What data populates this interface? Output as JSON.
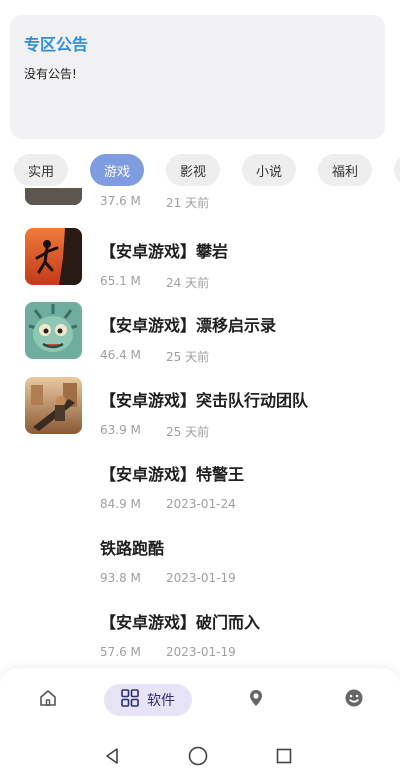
{
  "notice": {
    "title": "专区公告",
    "body": "没有公告!"
  },
  "tabs": [
    {
      "label": "实用",
      "active": false
    },
    {
      "label": "游戏",
      "active": true
    },
    {
      "label": "影视",
      "active": false
    },
    {
      "label": "小说",
      "active": false
    },
    {
      "label": "福利",
      "active": false
    }
  ],
  "items": [
    {
      "title": "",
      "size": "37.6 M",
      "date": "21 天前"
    },
    {
      "title": "【安卓游戏】攀岩",
      "size": "65.1 M",
      "date": "24 天前"
    },
    {
      "title": "【安卓游戏】漂移启示录",
      "size": "46.4 M",
      "date": "25 天前"
    },
    {
      "title": "【安卓游戏】突击队行动团队",
      "size": "63.9 M",
      "date": "25 天前"
    },
    {
      "title": "【安卓游戏】特警王",
      "size": "84.9 M",
      "date": "2023-01-24"
    },
    {
      "title": "铁路跑酷",
      "size": "93.8 M",
      "date": "2023-01-19"
    },
    {
      "title": "【安卓游戏】破门而入",
      "size": "57.6 M",
      "date": "2023-01-19"
    }
  ],
  "bottom_nav": {
    "active_label": "软件"
  },
  "colors": {
    "accent": "#7f9ce0",
    "notice_title": "#2f8fd8",
    "nav_active_bg": "#e6e4f6"
  }
}
